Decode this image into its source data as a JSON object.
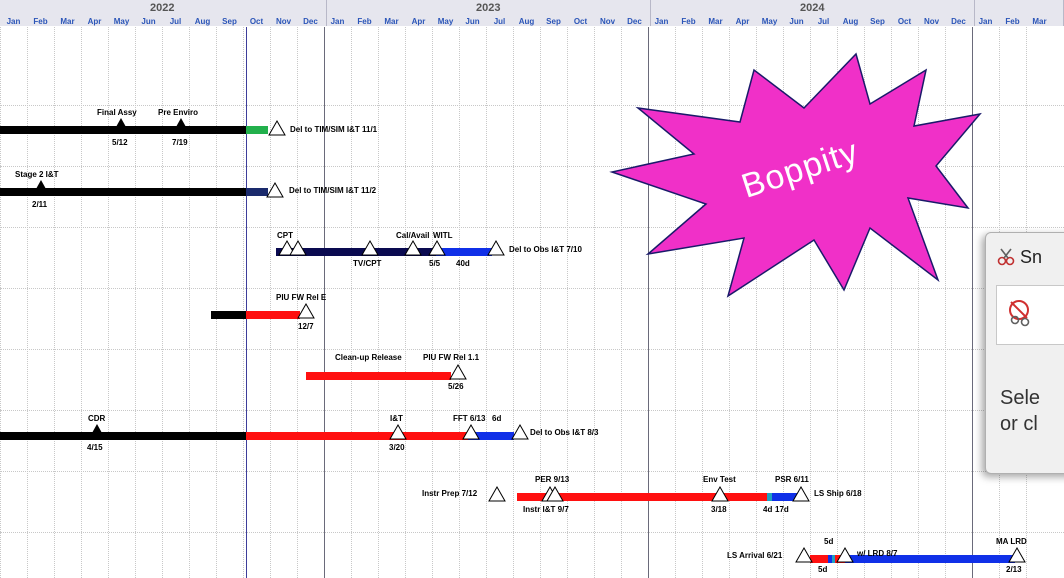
{
  "timeline": {
    "years": [
      "2022",
      "2023",
      "2024"
    ],
    "months": [
      "Jan",
      "Feb",
      "Mar",
      "Apr",
      "May",
      "Jun",
      "Jul",
      "Aug",
      "Sep",
      "Oct",
      "Nov",
      "Dec",
      "Jan",
      "Feb",
      "Mar",
      "Apr",
      "May",
      "Jun",
      "Jul",
      "Aug",
      "Sep",
      "Oct",
      "Nov",
      "Dec",
      "Jan",
      "Feb",
      "Mar",
      "Apr",
      "May",
      "Jun",
      "Jul",
      "Aug",
      "Sep",
      "Oct",
      "Nov",
      "Dec",
      "Jan",
      "Feb",
      "Mar"
    ]
  },
  "rows": {
    "r1": {
      "final_assy": "Final Assy",
      "final_assy_date": "5/12",
      "pre_enviro": "Pre Enviro",
      "pre_enviro_date": "7/19",
      "delivery": "Del to TIM/SIM I&T 11/1"
    },
    "r2": {
      "stage2": "Stage 2 I&T",
      "stage2_date": "2/11",
      "delivery": "Del to TIM/SIM I&T 11/2"
    },
    "r3": {
      "cpt": "CPT",
      "calavail": "Cal/Avail",
      "witl": "WITL",
      "tvcpt": "TV/CPT",
      "date": "5/5",
      "slack": "40d",
      "delivery": "Del to Obs I&T 7/10"
    },
    "r4": {
      "piu": "PIU FW Rel E",
      "date": "12/7"
    },
    "r5": {
      "cleanup": "Clean-up Release",
      "piu11": "PIU FW Rel 1.1",
      "date": "5/26"
    },
    "r6": {
      "cdr": "CDR",
      "cdr_date": "4/15",
      "it": "I&T",
      "it_date": "3/20",
      "fft": "FFT 6/13",
      "slack": "6d",
      "delivery": "Del to Obs I&T 8/3"
    },
    "r7": {
      "instr_prep": "Instr Prep 7/12",
      "per": "PER 9/13",
      "instr_it": "Instr I&T 9/7",
      "env_test": "Env Test",
      "env_date": "3/18",
      "psr": "PSR 6/11",
      "slack1": "4d",
      "slack2": "17d",
      "ls_ship": "LS Ship 6/18"
    },
    "r8": {
      "ls_arrival": "LS Arrival 6/21",
      "slack_top": "5d",
      "slack_bottom": "5d",
      "wrd": "w/ LRD 8/7",
      "ma_lrd": "MA LRD",
      "ma_date": "2/13"
    }
  },
  "overlay": {
    "burst_text": "Boppity",
    "burst_color": "#f030c8"
  },
  "snipping_tool": {
    "title": "Sn",
    "line1": "Sele",
    "line2": "or cl"
  },
  "colors": {
    "black": "#000000",
    "green": "#22b04c",
    "navy": "#1a2a6c",
    "darknavy": "#0a0a50",
    "blue": "#1030e8",
    "red": "#ff1010"
  }
}
